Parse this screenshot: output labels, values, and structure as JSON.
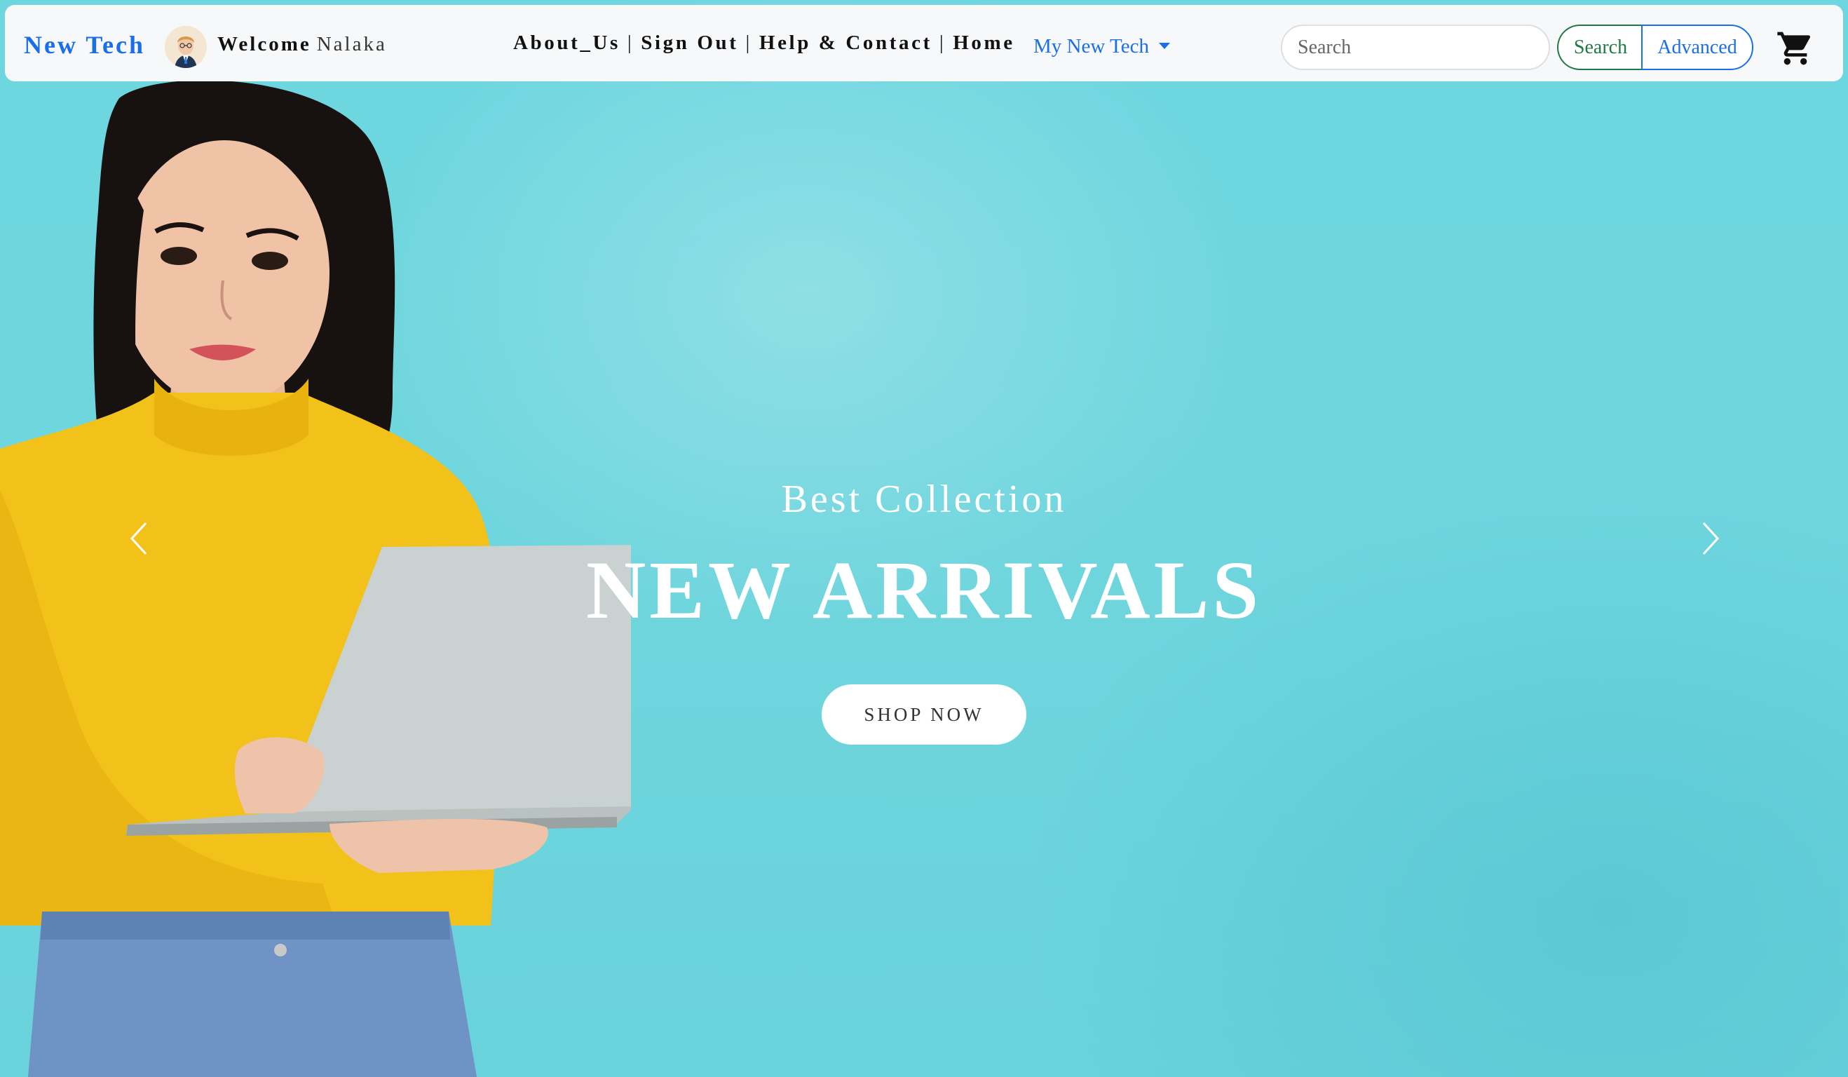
{
  "navbar": {
    "brand": "New Tech",
    "welcome_label": "Welcome",
    "user_name": "Nalaka",
    "links": [
      {
        "label": "About_Us"
      },
      {
        "label": "Sign Out"
      },
      {
        "label": "Help & Contact"
      },
      {
        "label": "Home"
      }
    ],
    "separator": "|",
    "dropdown_label": "My New Tech",
    "search_placeholder": "Search",
    "search_button": "Search",
    "advanced_button": "Advanced",
    "cart_icon": "shopping-cart-icon"
  },
  "hero": {
    "subtitle": "Best Collection",
    "headline": "NEW ARRIVALS",
    "cta_label": "SHOP NOW",
    "prev_icon": "chevron-left-icon",
    "next_icon": "chevron-right-icon"
  },
  "colors": {
    "brand": "#1a6ee8",
    "search_green": "#1f7a45",
    "hero_background": "#6dd6df",
    "sweater": "#f2c21a"
  }
}
